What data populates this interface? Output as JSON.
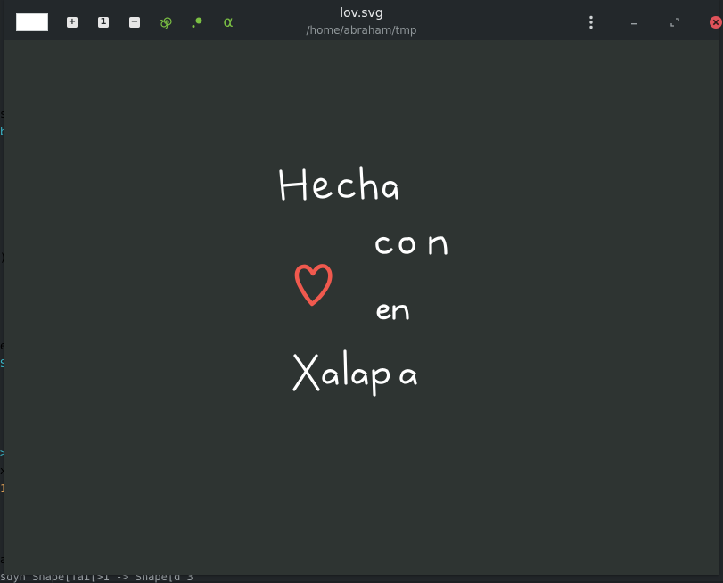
{
  "window": {
    "title": "lov.svg",
    "subtitle": "/home/abraham/tmp"
  },
  "toolbar": {
    "color_swatch": "#ffffff",
    "plus_label": "+",
    "one_label": "1",
    "minus_label": "−",
    "spiral_icon": "spiral-icon",
    "dot_tool_icon": "dot-brush-icon",
    "alpha_label": "α",
    "tool_accent_color": "#7bc043"
  },
  "controls": {
    "menu_icon": "kebab-menu-icon",
    "minimize_icon": "minimize-icon",
    "restore_icon": "restore-icon",
    "close_icon": "close-icon",
    "close_color": "#e0535a"
  },
  "drawing": {
    "words": [
      "Hecha",
      "con",
      "en",
      "Xalapa"
    ],
    "ink_color": "#ffffff",
    "heart_color": "#f0594e",
    "background": "#2e3432"
  },
  "background_terminal": {
    "fragments": [
      {
        "text": "s",
        "color": "#9aa0a4"
      },
      {
        "text": "b",
        "color": "#3ab7c9"
      },
      {
        "text": ")",
        "color": "#9aa0a4"
      },
      {
        "text": "e",
        "color": "#9aa0a4"
      },
      {
        "text": "S",
        "color": "#3ab7c9"
      },
      {
        "text": ">",
        "color": "#3ab7c9"
      },
      {
        "text": "x",
        "color": "#9aa0a4"
      },
      {
        "text": "1",
        "color": "#e2a55a"
      },
      {
        "text": "a",
        "color": "#9aa0a4"
      }
    ],
    "bottom_line": "sdyn Shape[Tai[>1 -> Shape[d 3"
  }
}
